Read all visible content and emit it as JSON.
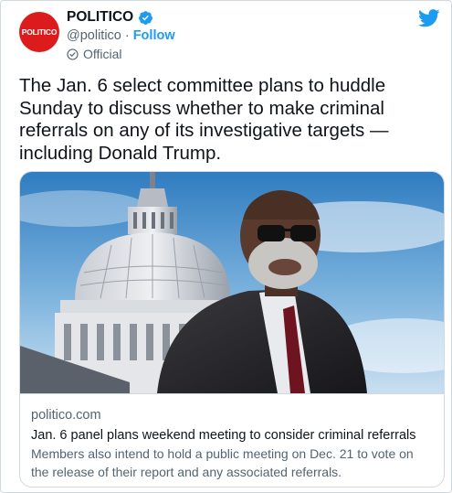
{
  "account": {
    "avatar_text": "POLITICO",
    "name": "POLITICO",
    "handle": "@politico",
    "separator": "·",
    "follow_label": "Follow",
    "official_label": "Official"
  },
  "tweet": {
    "text": "The Jan. 6 select committee plans to huddle Sunday to discuss whether to make criminal referrals on any of its investigative targets — including Donald Trump."
  },
  "card": {
    "domain": "politico.com",
    "title": "Jan. 6 panel plans weekend meeting to consider criminal referrals",
    "description": "Members also intend to hold a public meeting on Dec. 21 to vote on the release of their report and any associated referrals."
  },
  "colors": {
    "brand_red": "#dc1c1c",
    "twitter_blue": "#1d9bf0",
    "text_primary": "#0f1419",
    "text_secondary": "#536471",
    "border": "#cfd9de"
  },
  "icons": {
    "verified": "verified-badge-icon",
    "official": "government-badge-icon",
    "logo": "twitter-bird-icon"
  }
}
